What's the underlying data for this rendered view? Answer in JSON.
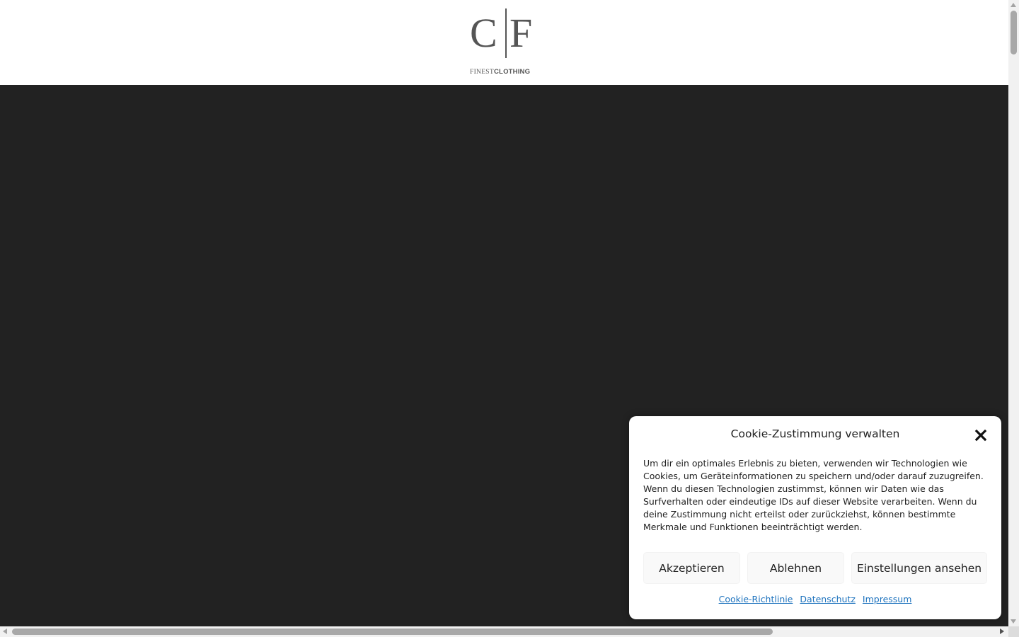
{
  "brand": {
    "logo_c": "C",
    "logo_f": "F",
    "tag_finest": "FINEST",
    "tag_clothing": "CLOTHING"
  },
  "cookie": {
    "title": "Cookie-Zustimmung verwalten",
    "text": "Um dir ein optimales Erlebnis zu bieten, verwenden wir Technologien wie Cookies, um Geräteinformationen zu speichern und/oder darauf zuzugreifen. Wenn du diesen Technologien zustimmst, können wir Daten wie das Surfverhalten oder eindeutige IDs auf dieser Website verarbeiten. Wenn du deine Zustimmung nicht erteilst oder zurückziehst, können bestimmte Merkmale und Funktionen beeinträchtigt werden.",
    "accept_label": "Akzeptieren",
    "deny_label": "Ablehnen",
    "preferences_label": "Einstellungen ansehen",
    "links": {
      "cookie_policy": "Cookie-Richtlinie",
      "privacy": "Datenschutz",
      "imprint": "Impressum"
    },
    "close_icon": "close-icon"
  },
  "colors": {
    "hero_background": "#222222",
    "link": "#1e73be",
    "logo": "#555555"
  }
}
